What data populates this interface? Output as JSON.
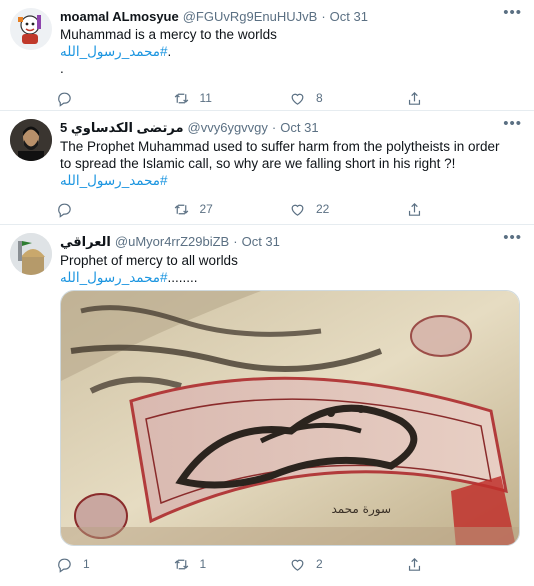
{
  "tweets": [
    {
      "name": "moamal ALmosyue",
      "handle": "@FGUvRg9EnuHUJvB",
      "dot": "·",
      "time": "Oct 31",
      "lines": [
        "Muhammad is a mercy to the worlds"
      ],
      "hashtag": "#محمد_رسول_الله",
      "hashtag_suffix": ".",
      "extra_line": ".",
      "replies": "",
      "retweets": "11",
      "likes": "8"
    },
    {
      "name": "مرتضى الكدساوي 5",
      "handle": "@vvy6ygvvgy",
      "dot": "·",
      "time": "Oct 31",
      "lines": [
        "The Prophet Muhammad used to suffer harm from the polytheists in order",
        "to spread the Islamic call, so why are we falling short in his right ?!"
      ],
      "hashtag": "#محمد_رسول_الله",
      "hashtag_suffix": "",
      "replies": "",
      "retweets": "27",
      "likes": "22"
    },
    {
      "name": "العراقي",
      "handle": "@uMyor4rrZ29biZB",
      "dot": "·",
      "time": "Oct 31",
      "lines": [
        "Prophet of mercy to all worlds"
      ],
      "hashtag": "#محمد_رسول_الله",
      "hashtag_suffix": "........",
      "image_text": "سورة محمد",
      "replies": "1",
      "retweets": "1",
      "likes": "2"
    }
  ],
  "colors": {
    "accent": "#1b95e0",
    "secondary_text": "#5b7083",
    "divider": "#e6ecf0"
  },
  "icons": [
    "more-icon",
    "reply-icon",
    "retweet-icon",
    "like-icon",
    "share-icon"
  ]
}
